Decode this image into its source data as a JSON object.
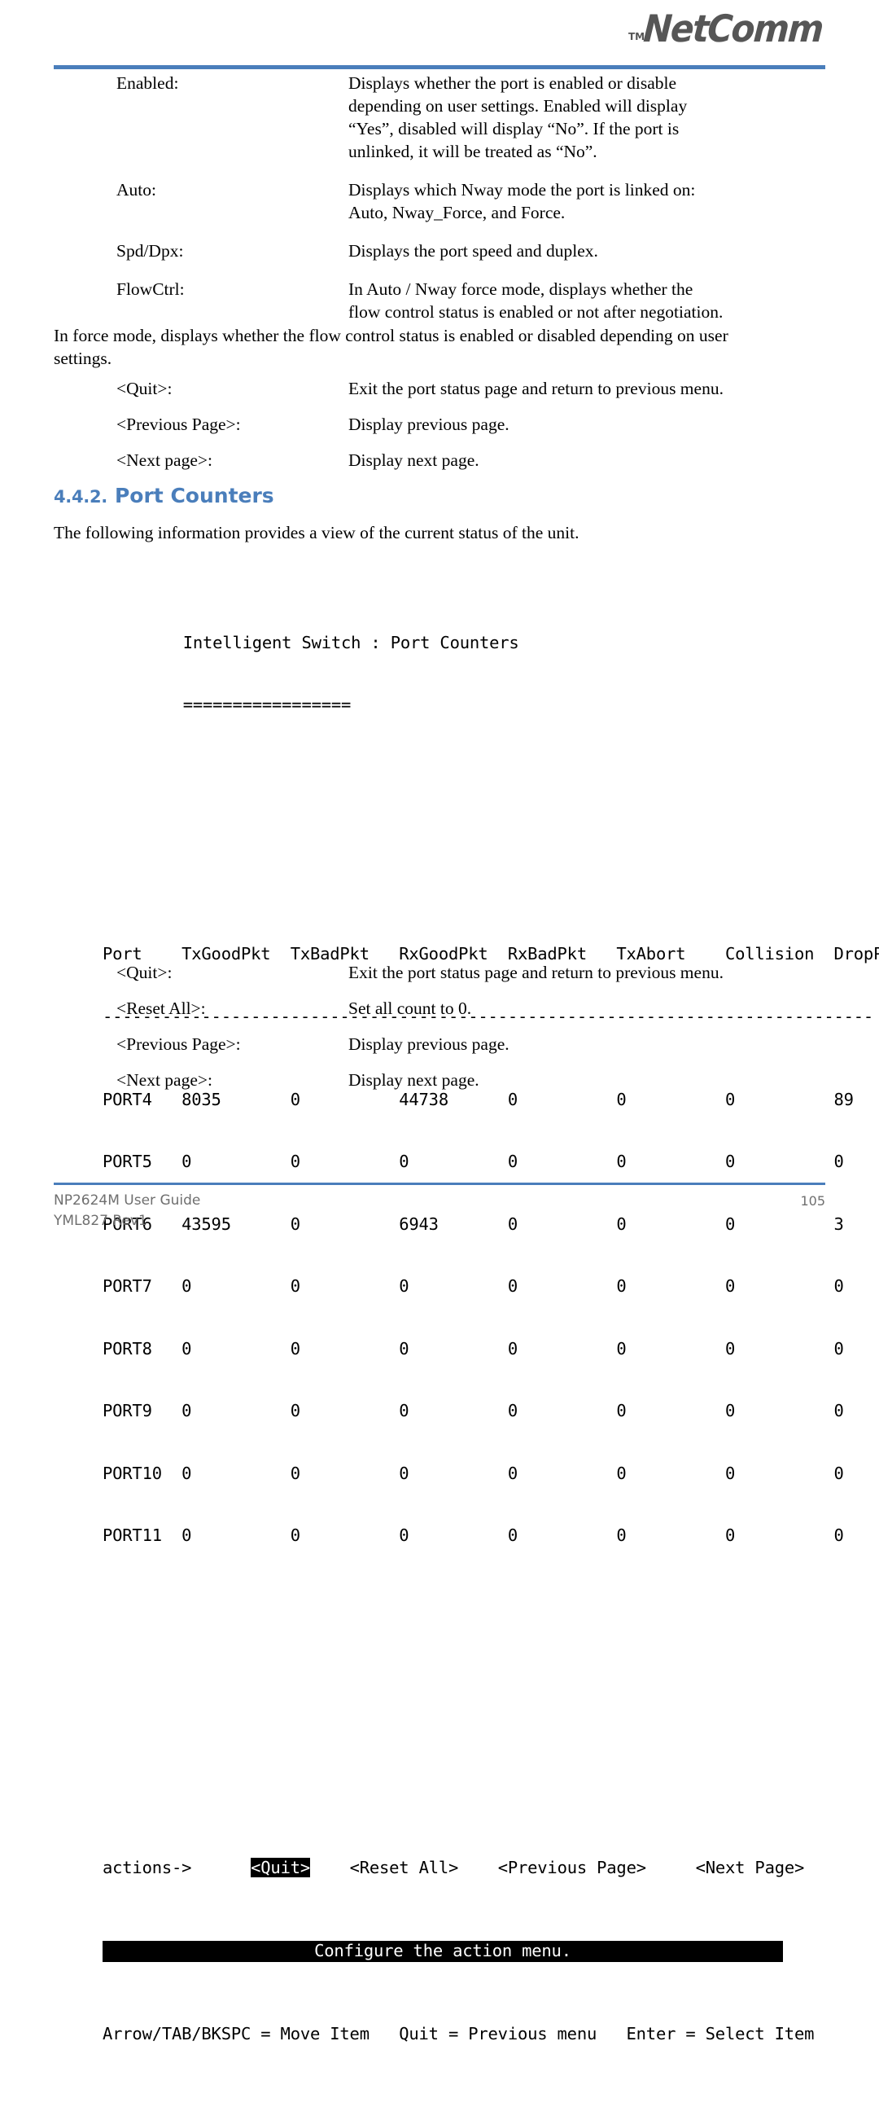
{
  "brand": {
    "logo_text": "NetComm",
    "logo_tm": "TM"
  },
  "colors": {
    "accent": "#4a7ebb",
    "logo_gray": "#565656",
    "footer_gray": "#6f6f6f"
  },
  "definitions_top": [
    {
      "term": "Enabled:",
      "lines": [
        "Displays whether the port is enabled or disable",
        "depending on user settings.  Enabled will display",
        "“Yes”, disabled will display “No”.  If the port is",
        "unlinked, it will be treated as “No”."
      ]
    },
    {
      "term": "Auto:",
      "lines": [
        "Displays which Nway mode the port is linked on:",
        "Auto, Nway_Force, and Force."
      ]
    },
    {
      "term": "Spd/Dpx:",
      "lines": [
        "Displays the port speed and duplex."
      ]
    },
    {
      "term": "FlowCtrl:",
      "lines": [
        "In Auto / Nway force mode, displays whether the",
        "flow control status is enabled or not after negotiation."
      ]
    }
  ],
  "paragraph_force_mode": {
    "line1": "In force mode, displays whether the flow control status is enabled or disabled depending on user",
    "line2": "settings."
  },
  "definitions_mid": [
    {
      "term": "<Quit>:",
      "desc": "Exit the port status page and return to previous menu."
    },
    {
      "term": "<Previous Page>:",
      "desc": "Display previous page."
    },
    {
      "term": "<Next page>:",
      "desc": "Display next page."
    }
  ],
  "section": {
    "number": "4.4.2.",
    "title": "Port Counters",
    "intro": "The following information provides a view of the current status of the unit."
  },
  "terminal": {
    "title": "Intelligent Switch : Port Counters",
    "title_rule": "=================",
    "columns": [
      "Port",
      "TxGoodPkt",
      "TxBadPkt",
      "RxGoodPkt",
      "RxBadPkt",
      "TxAbort",
      "Collision",
      "DropPkt"
    ],
    "header_line": "Port    TxGoodPkt  TxBadPkt   RxGoodPkt  RxBadPkt   TxAbort    Collision  DropPkt",
    "separator_line": "------------------------------------------------------------------------------",
    "rows": [
      {
        "port": "PORT4",
        "tx_good": "8035",
        "tx_bad": "0",
        "rx_good": "44738",
        "rx_bad": "0",
        "tx_abort": "0",
        "collision": "0",
        "drop": "89",
        "line": "PORT4   8035       0          44738      0          0          0          89"
      },
      {
        "port": "PORT5",
        "tx_good": "0",
        "tx_bad": "0",
        "rx_good": "0",
        "rx_bad": "0",
        "tx_abort": "0",
        "collision": "0",
        "drop": "0",
        "line": "PORT5   0          0          0          0          0          0          0"
      },
      {
        "port": "PORT6",
        "tx_good": "43595",
        "tx_bad": "0",
        "rx_good": "6943",
        "rx_bad": "0",
        "tx_abort": "0",
        "collision": "0",
        "drop": "3",
        "line": "PORT6   43595      0          6943       0          0          0          3"
      },
      {
        "port": "PORT7",
        "tx_good": "0",
        "tx_bad": "0",
        "rx_good": "0",
        "rx_bad": "0",
        "tx_abort": "0",
        "collision": "0",
        "drop": "0",
        "line": "PORT7   0          0          0          0          0          0          0"
      },
      {
        "port": "PORT8",
        "tx_good": "0",
        "tx_bad": "0",
        "rx_good": "0",
        "rx_bad": "0",
        "tx_abort": "0",
        "collision": "0",
        "drop": "0",
        "line": "PORT8   0          0          0          0          0          0          0"
      },
      {
        "port": "PORT9",
        "tx_good": "0",
        "tx_bad": "0",
        "rx_good": "0",
        "rx_bad": "0",
        "tx_abort": "0",
        "collision": "0",
        "drop": "0",
        "line": "PORT9   0          0          0          0          0          0          0"
      },
      {
        "port": "PORT10",
        "tx_good": "0",
        "tx_bad": "0",
        "rx_good": "0",
        "rx_bad": "0",
        "tx_abort": "0",
        "collision": "0",
        "drop": "0",
        "line": "PORT10  0          0          0          0          0          0          0"
      },
      {
        "port": "PORT11",
        "tx_good": "0",
        "tx_bad": "0",
        "rx_good": "0",
        "rx_bad": "0",
        "tx_abort": "0",
        "collision": "0",
        "drop": "0",
        "line": "PORT11  0          0          0          0          0          0          0"
      }
    ],
    "actions": {
      "label": "actions->",
      "items": [
        {
          "label": "<Quit>",
          "selected": true
        },
        {
          "label": "<Reset All>",
          "selected": false
        },
        {
          "label": "<Previous Page>",
          "selected": false
        },
        {
          "label": "<Next Page>",
          "selected": false
        }
      ],
      "gap_1": "      ",
      "gap_2": "    ",
      "gap_3": "    ",
      "gap_4": "     "
    },
    "status_bar": "Configure the action menu.",
    "help_line": "Arrow/TAB/BKSPC = Move Item   Quit = Previous menu   Enter = Select Item"
  },
  "definitions_bottom": [
    {
      "term": "<Quit>:",
      "desc": "Exit the port status page and return to previous menu."
    },
    {
      "term": "<Reset All>:",
      "desc": "Set all count to 0."
    },
    {
      "term": "<Previous Page>:",
      "desc": "Display previous page."
    },
    {
      "term": "<Next page>:",
      "desc": "Display next page."
    }
  ],
  "footer": {
    "line1": "NP2624M User Guide",
    "line2": "YML827 Rev1",
    "page_number": "105"
  }
}
